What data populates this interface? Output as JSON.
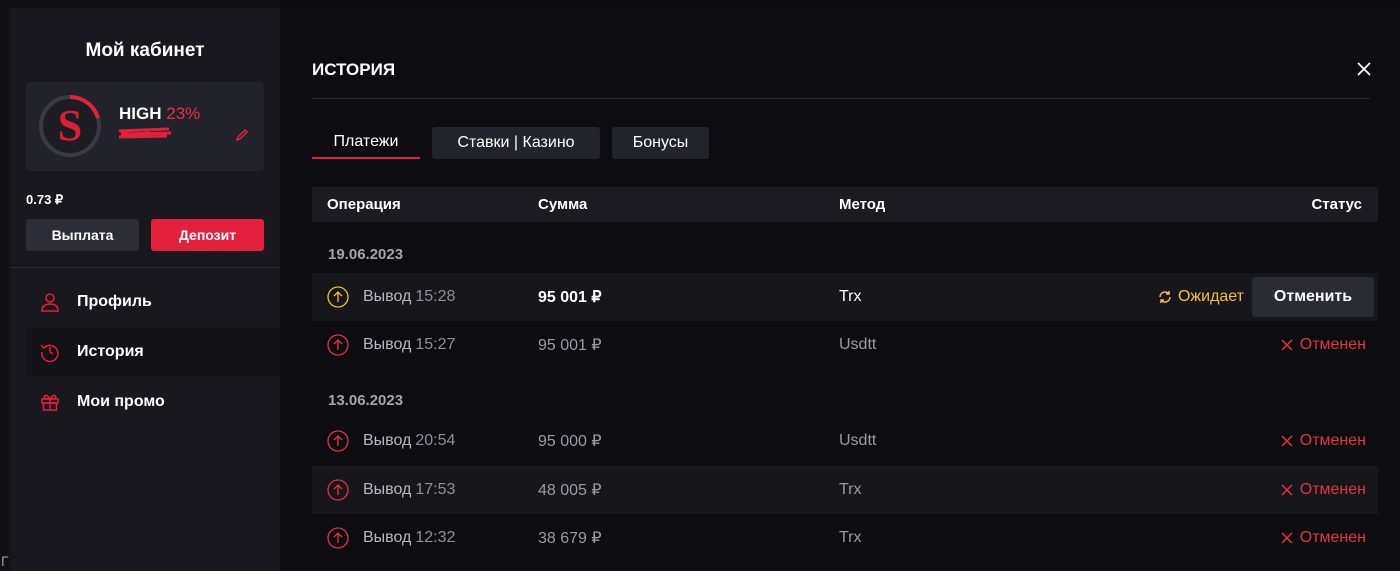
{
  "sidebar": {
    "title": "Мой кабинет",
    "level_name": "HIGH",
    "level_percent": "23%",
    "level_progress": 0.23,
    "balance": "0.73 ₽",
    "payout_label": "Выплата",
    "deposit_label": "Депозит",
    "nav": [
      {
        "label": "Профиль",
        "icon": "user-icon"
      },
      {
        "label": "История",
        "icon": "history-icon"
      },
      {
        "label": "Мои промо",
        "icon": "gift-icon"
      }
    ],
    "corner_glyph": "Г"
  },
  "main": {
    "title": "ИСТОРИЯ",
    "tabs": [
      {
        "label": "Платежи",
        "active": true
      },
      {
        "label": "Ставки | Казино",
        "active": false
      },
      {
        "label": "Бонусы",
        "active": false
      }
    ],
    "columns": {
      "operation": "Операция",
      "amount": "Сумма",
      "method": "Метод",
      "status": "Статус"
    },
    "groups": [
      {
        "date": "19.06.2023",
        "rows": [
          {
            "type": "Вывод",
            "time": "15:28",
            "amount": "95 001 ₽",
            "method": "Trx",
            "status": "Ожидает",
            "status_kind": "pending",
            "action": "Отменить"
          },
          {
            "type": "Вывод",
            "time": "15:27",
            "amount": "95 001 ₽",
            "method": "Usdtt",
            "status": "Отменен",
            "status_kind": "cancelled"
          }
        ]
      },
      {
        "date": "13.06.2023",
        "rows": [
          {
            "type": "Вывод",
            "time": "20:54",
            "amount": "95 000 ₽",
            "method": "Usdtt",
            "status": "Отменен",
            "status_kind": "cancelled"
          },
          {
            "type": "Вывод",
            "time": "17:53",
            "amount": "48 005 ₽",
            "method": "Trx",
            "status": "Отменен",
            "status_kind": "cancelled"
          },
          {
            "type": "Вывод",
            "time": "12:32",
            "amount": "38 679 ₽",
            "method": "Trx",
            "status": "Отменен",
            "status_kind": "cancelled"
          }
        ]
      }
    ]
  },
  "colors": {
    "accent": "#e3213d",
    "pending": "#f0c23a",
    "cancelled": "#e23345"
  }
}
